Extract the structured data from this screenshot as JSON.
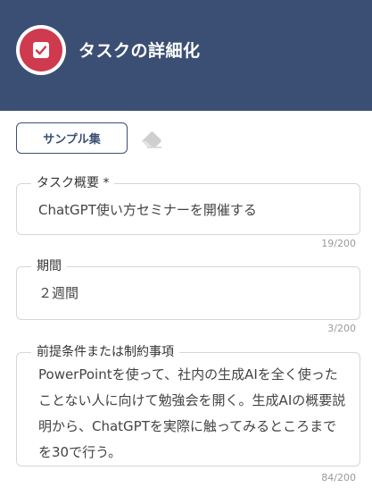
{
  "header": {
    "title": "タスクの詳細化",
    "logo_icon": "check-box-icon",
    "background_color": "#3b4f74",
    "accent_color": "#cf3a4f"
  },
  "toolbar": {
    "sample_button_label": "サンプル集",
    "clear_icon": "eraser-icon"
  },
  "fields": {
    "task_summary": {
      "label": "タスク概要 *",
      "value": "ChatGPT使い方セミナーを開催する",
      "counter": "19/200"
    },
    "period": {
      "label": "期間",
      "value": "２週間",
      "counter": "3/200"
    },
    "constraints": {
      "label": "前提条件または制約事項",
      "value": "PowerPointを使って、社内の生成AIを全く使ったことない人に向けて勉強会を開く。生成AIの概要説明から、ChatGPTを実際に触ってみるところまでを30で行う。",
      "counter": "84/200"
    }
  }
}
